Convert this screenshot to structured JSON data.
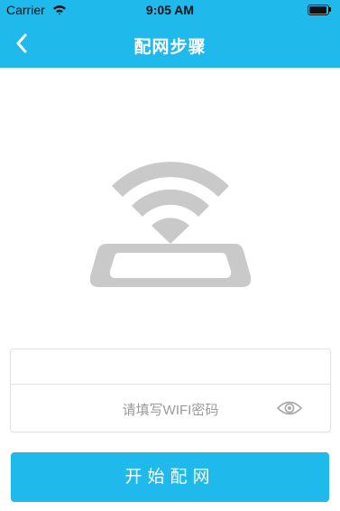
{
  "status_bar": {
    "carrier": "Carrier",
    "time": "9:05 AM",
    "icons": [
      "wifi-signal-icon",
      "battery-icon"
    ]
  },
  "navbar": {
    "title": "配网步骤",
    "back_icon": "chevron-left-icon"
  },
  "illustration": {
    "icon": "router-wifi-icon"
  },
  "form": {
    "ssid_value": "",
    "password_placeholder": "请填写WIFI密码",
    "password_value": "",
    "visibility_icon": "eye-icon"
  },
  "actions": {
    "start_label": "开始配网"
  },
  "colors": {
    "primary": "#1fb9eb",
    "illustration_gray": "#c9c9c9",
    "placeholder_text": "#9a9a9a",
    "border": "#e3e3e3"
  }
}
